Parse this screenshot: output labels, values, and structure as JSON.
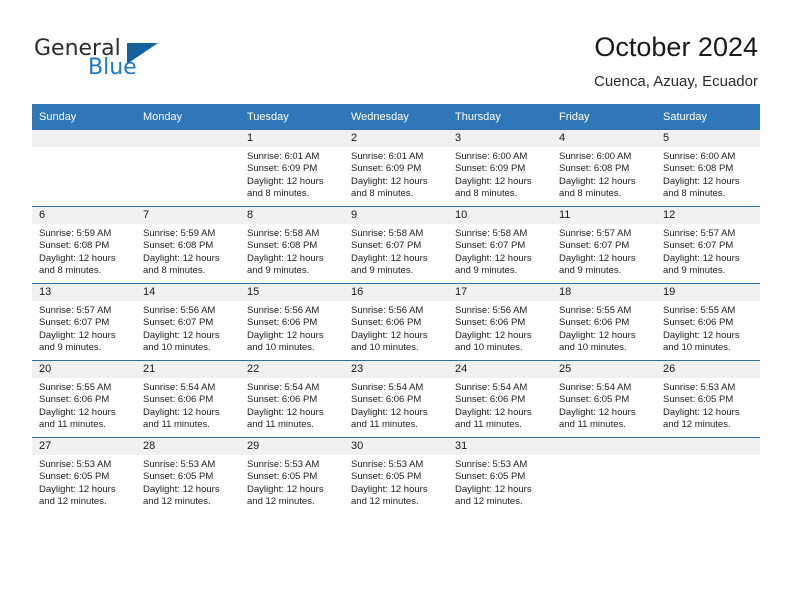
{
  "brand": {
    "name_top": "General",
    "name_bottom": "Blue",
    "triangle_color": "#14619e",
    "blue_color": "#1f7ac4"
  },
  "header": {
    "title": "October 2024",
    "subtitle": "Cuenca, Azuay, Ecuador"
  },
  "calendar": {
    "header_bg": "#2f77b8",
    "weekdays": [
      "Sunday",
      "Monday",
      "Tuesday",
      "Wednesday",
      "Thursday",
      "Friday",
      "Saturday"
    ],
    "weeks": [
      [
        {
          "day": "",
          "empty": true
        },
        {
          "day": "",
          "empty": true
        },
        {
          "day": "1",
          "sunrise": "Sunrise: 6:01 AM",
          "sunset": "Sunset: 6:09 PM",
          "daylight": "Daylight: 12 hours and 8 minutes."
        },
        {
          "day": "2",
          "sunrise": "Sunrise: 6:01 AM",
          "sunset": "Sunset: 6:09 PM",
          "daylight": "Daylight: 12 hours and 8 minutes."
        },
        {
          "day": "3",
          "sunrise": "Sunrise: 6:00 AM",
          "sunset": "Sunset: 6:09 PM",
          "daylight": "Daylight: 12 hours and 8 minutes."
        },
        {
          "day": "4",
          "sunrise": "Sunrise: 6:00 AM",
          "sunset": "Sunset: 6:08 PM",
          "daylight": "Daylight: 12 hours and 8 minutes."
        },
        {
          "day": "5",
          "sunrise": "Sunrise: 6:00 AM",
          "sunset": "Sunset: 6:08 PM",
          "daylight": "Daylight: 12 hours and 8 minutes."
        }
      ],
      [
        {
          "day": "6",
          "sunrise": "Sunrise: 5:59 AM",
          "sunset": "Sunset: 6:08 PM",
          "daylight": "Daylight: 12 hours and 8 minutes."
        },
        {
          "day": "7",
          "sunrise": "Sunrise: 5:59 AM",
          "sunset": "Sunset: 6:08 PM",
          "daylight": "Daylight: 12 hours and 8 minutes."
        },
        {
          "day": "8",
          "sunrise": "Sunrise: 5:58 AM",
          "sunset": "Sunset: 6:08 PM",
          "daylight": "Daylight: 12 hours and 9 minutes."
        },
        {
          "day": "9",
          "sunrise": "Sunrise: 5:58 AM",
          "sunset": "Sunset: 6:07 PM",
          "daylight": "Daylight: 12 hours and 9 minutes."
        },
        {
          "day": "10",
          "sunrise": "Sunrise: 5:58 AM",
          "sunset": "Sunset: 6:07 PM",
          "daylight": "Daylight: 12 hours and 9 minutes."
        },
        {
          "day": "11",
          "sunrise": "Sunrise: 5:57 AM",
          "sunset": "Sunset: 6:07 PM",
          "daylight": "Daylight: 12 hours and 9 minutes."
        },
        {
          "day": "12",
          "sunrise": "Sunrise: 5:57 AM",
          "sunset": "Sunset: 6:07 PM",
          "daylight": "Daylight: 12 hours and 9 minutes."
        }
      ],
      [
        {
          "day": "13",
          "sunrise": "Sunrise: 5:57 AM",
          "sunset": "Sunset: 6:07 PM",
          "daylight": "Daylight: 12 hours and 9 minutes."
        },
        {
          "day": "14",
          "sunrise": "Sunrise: 5:56 AM",
          "sunset": "Sunset: 6:07 PM",
          "daylight": "Daylight: 12 hours and 10 minutes."
        },
        {
          "day": "15",
          "sunrise": "Sunrise: 5:56 AM",
          "sunset": "Sunset: 6:06 PM",
          "daylight": "Daylight: 12 hours and 10 minutes."
        },
        {
          "day": "16",
          "sunrise": "Sunrise: 5:56 AM",
          "sunset": "Sunset: 6:06 PM",
          "daylight": "Daylight: 12 hours and 10 minutes."
        },
        {
          "day": "17",
          "sunrise": "Sunrise: 5:56 AM",
          "sunset": "Sunset: 6:06 PM",
          "daylight": "Daylight: 12 hours and 10 minutes."
        },
        {
          "day": "18",
          "sunrise": "Sunrise: 5:55 AM",
          "sunset": "Sunset: 6:06 PM",
          "daylight": "Daylight: 12 hours and 10 minutes."
        },
        {
          "day": "19",
          "sunrise": "Sunrise: 5:55 AM",
          "sunset": "Sunset: 6:06 PM",
          "daylight": "Daylight: 12 hours and 10 minutes."
        }
      ],
      [
        {
          "day": "20",
          "sunrise": "Sunrise: 5:55 AM",
          "sunset": "Sunset: 6:06 PM",
          "daylight": "Daylight: 12 hours and 11 minutes."
        },
        {
          "day": "21",
          "sunrise": "Sunrise: 5:54 AM",
          "sunset": "Sunset: 6:06 PM",
          "daylight": "Daylight: 12 hours and 11 minutes."
        },
        {
          "day": "22",
          "sunrise": "Sunrise: 5:54 AM",
          "sunset": "Sunset: 6:06 PM",
          "daylight": "Daylight: 12 hours and 11 minutes."
        },
        {
          "day": "23",
          "sunrise": "Sunrise: 5:54 AM",
          "sunset": "Sunset: 6:06 PM",
          "daylight": "Daylight: 12 hours and 11 minutes."
        },
        {
          "day": "24",
          "sunrise": "Sunrise: 5:54 AM",
          "sunset": "Sunset: 6:06 PM",
          "daylight": "Daylight: 12 hours and 11 minutes."
        },
        {
          "day": "25",
          "sunrise": "Sunrise: 5:54 AM",
          "sunset": "Sunset: 6:05 PM",
          "daylight": "Daylight: 12 hours and 11 minutes."
        },
        {
          "day": "26",
          "sunrise": "Sunrise: 5:53 AM",
          "sunset": "Sunset: 6:05 PM",
          "daylight": "Daylight: 12 hours and 12 minutes."
        }
      ],
      [
        {
          "day": "27",
          "sunrise": "Sunrise: 5:53 AM",
          "sunset": "Sunset: 6:05 PM",
          "daylight": "Daylight: 12 hours and 12 minutes."
        },
        {
          "day": "28",
          "sunrise": "Sunrise: 5:53 AM",
          "sunset": "Sunset: 6:05 PM",
          "daylight": "Daylight: 12 hours and 12 minutes."
        },
        {
          "day": "29",
          "sunrise": "Sunrise: 5:53 AM",
          "sunset": "Sunset: 6:05 PM",
          "daylight": "Daylight: 12 hours and 12 minutes."
        },
        {
          "day": "30",
          "sunrise": "Sunrise: 5:53 AM",
          "sunset": "Sunset: 6:05 PM",
          "daylight": "Daylight: 12 hours and 12 minutes."
        },
        {
          "day": "31",
          "sunrise": "Sunrise: 5:53 AM",
          "sunset": "Sunset: 6:05 PM",
          "daylight": "Daylight: 12 hours and 12 minutes."
        },
        {
          "day": "",
          "empty": true
        },
        {
          "day": "",
          "empty": true
        }
      ]
    ]
  }
}
